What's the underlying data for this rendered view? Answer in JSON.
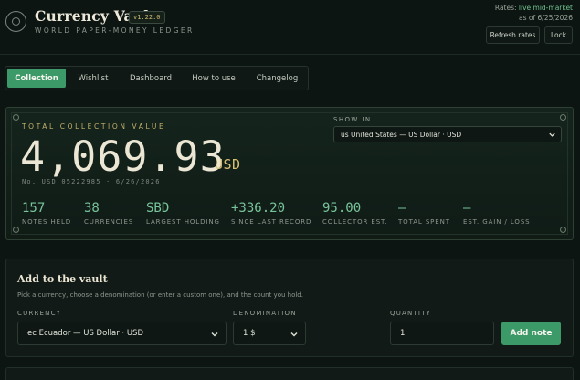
{
  "header": {
    "title": "Currency Vault",
    "version": "v1.22.0",
    "subtitle": "WORLD PAPER-MONEY LEDGER",
    "rates_prefix": "Rates: ",
    "rates_live": "live mid-market",
    "rates_date": "as of 6/25/2026",
    "refresh_label": "Refresh rates",
    "lock_label": "Lock"
  },
  "tabs": [
    {
      "label": "Collection",
      "active": true
    },
    {
      "label": "Wishlist",
      "active": false
    },
    {
      "label": "Dashboard",
      "active": false
    },
    {
      "label": "How to use",
      "active": false
    },
    {
      "label": "Changelog",
      "active": false
    }
  ],
  "summary": {
    "total_label": "TOTAL COLLECTION VALUE",
    "total_value": "4,069.93",
    "total_unit": "USD",
    "serial": "No. USD 05222985 · 6/26/2026",
    "show_in_label": "SHOW IN",
    "show_in_value": "us United States — US Dollar · USD",
    "stats": [
      {
        "value": "157",
        "label": "NOTES HELD"
      },
      {
        "value": "38",
        "label": "CURRENCIES"
      },
      {
        "value": "SBD",
        "label": "LARGEST HOLDING"
      },
      {
        "value": "+336.20",
        "label": "SINCE LAST RECORD"
      },
      {
        "value": "95.00",
        "label": "COLLECTOR EST."
      },
      {
        "value": "—",
        "label": "TOTAL SPENT"
      },
      {
        "value": "—",
        "label": "EST. GAIN / LOSS"
      }
    ]
  },
  "add_note": {
    "title": "Add to the vault",
    "description": "Pick a currency, choose a denomination (or enter a custom one), and the count you hold.",
    "currency_label": "CURRENCY",
    "currency_value": "ec Ecuador — US Dollar · USD",
    "denomination_label": "DENOMINATION",
    "denomination_value": "1 $",
    "quantity_label": "QUANTITY",
    "quantity_value": "1",
    "add_button": "Add note"
  },
  "colors": {
    "accent": "#3c9a68",
    "stat_value": "#79c49b",
    "gold": "#c4b06a",
    "background": "#0d1512"
  }
}
